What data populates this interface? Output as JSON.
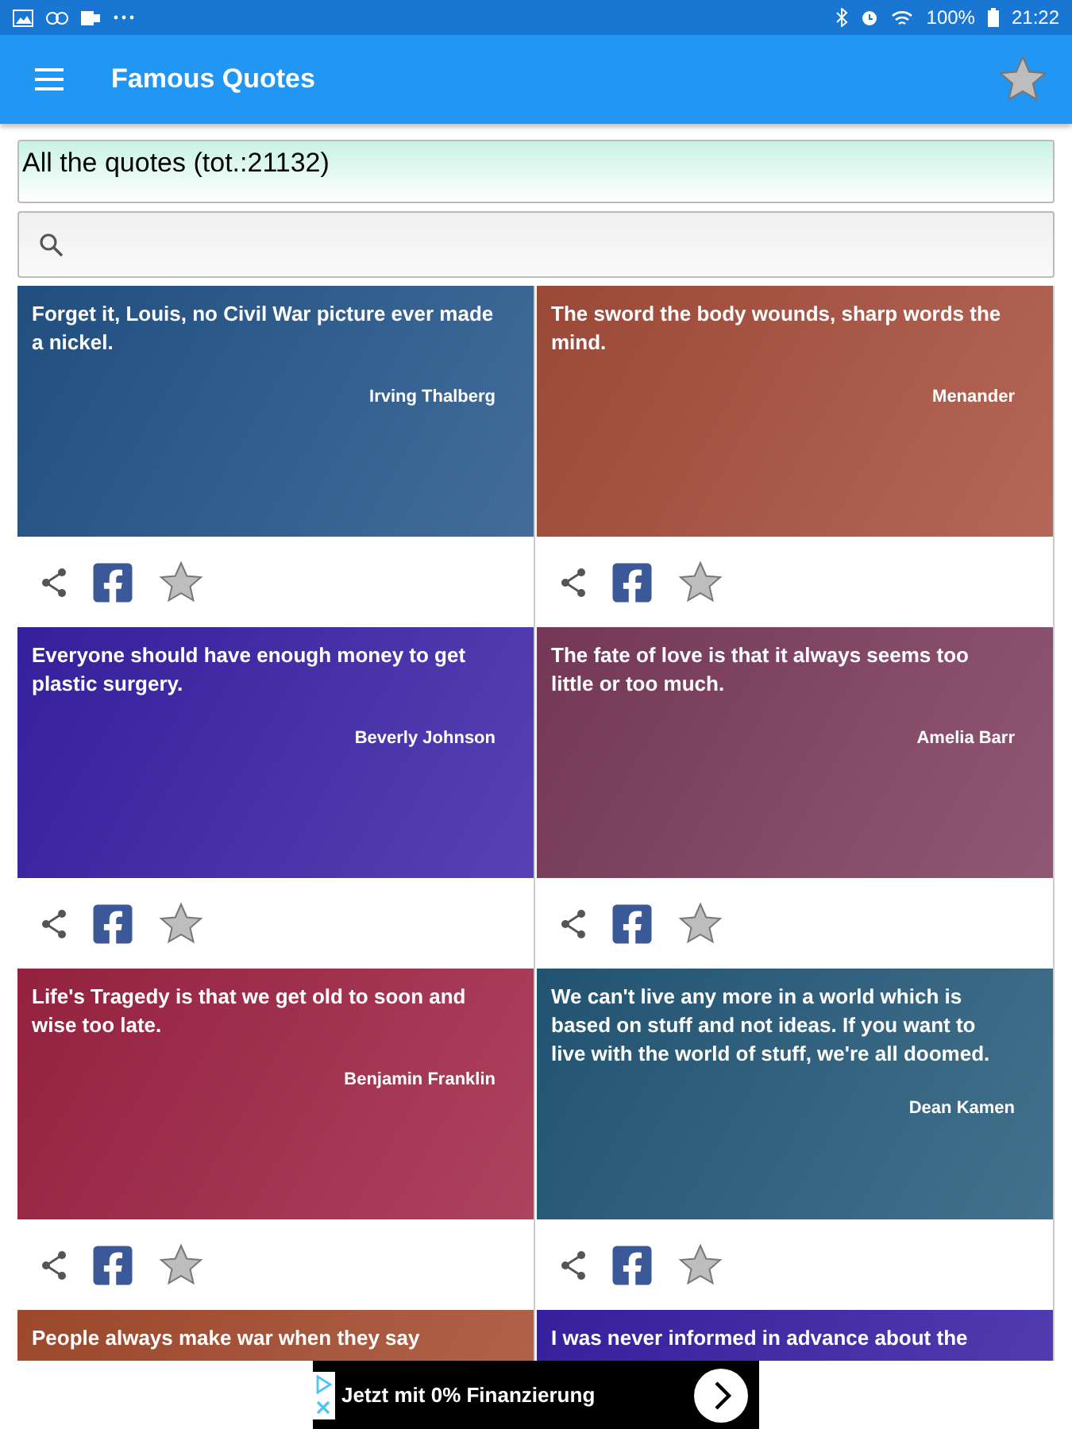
{
  "status_bar": {
    "battery": "100%",
    "time": "21:22"
  },
  "app_bar": {
    "title": "Famous Quotes"
  },
  "header": {
    "text": "All the quotes (tot.:21132)"
  },
  "quotes": [
    {
      "text": "Forget it, Louis, no Civil War picture ever made a nickel.",
      "author": "Irving Thalberg",
      "color": "#23558a",
      "favorite": false
    },
    {
      "text": "The sword the body wounds, sharp words the mind.",
      "author": "Menander",
      "color": "#a84e3c",
      "favorite": false
    },
    {
      "text": "Everyone should have enough money to get plastic surgery.",
      "author": "Beverly Johnson",
      "color": "#3a22a8",
      "favorite": false
    },
    {
      "text": "The fate of love is that it always seems too little or too much.",
      "author": "Amelia Barr",
      "color": "#7e3c5e",
      "favorite": false
    },
    {
      "text": "Life's Tragedy is that we get old to soon and wise too late.",
      "author": "Benjamin Franklin",
      "color": "#a02444",
      "favorite": false
    },
    {
      "text": "We can't live any more in a world which is based on stuff and not ideas. If you want to live with the world of stuff, we're all doomed.",
      "author": "Dean Kamen",
      "color": "#245a7a",
      "favorite": false
    },
    {
      "text": "People always make war when they say",
      "color": "#a84e30"
    },
    {
      "text": "I was never informed in advance about the",
      "color": "#3a22a8"
    }
  ],
  "ad": {
    "text": "Jetzt mit 0% Finanzierung"
  }
}
